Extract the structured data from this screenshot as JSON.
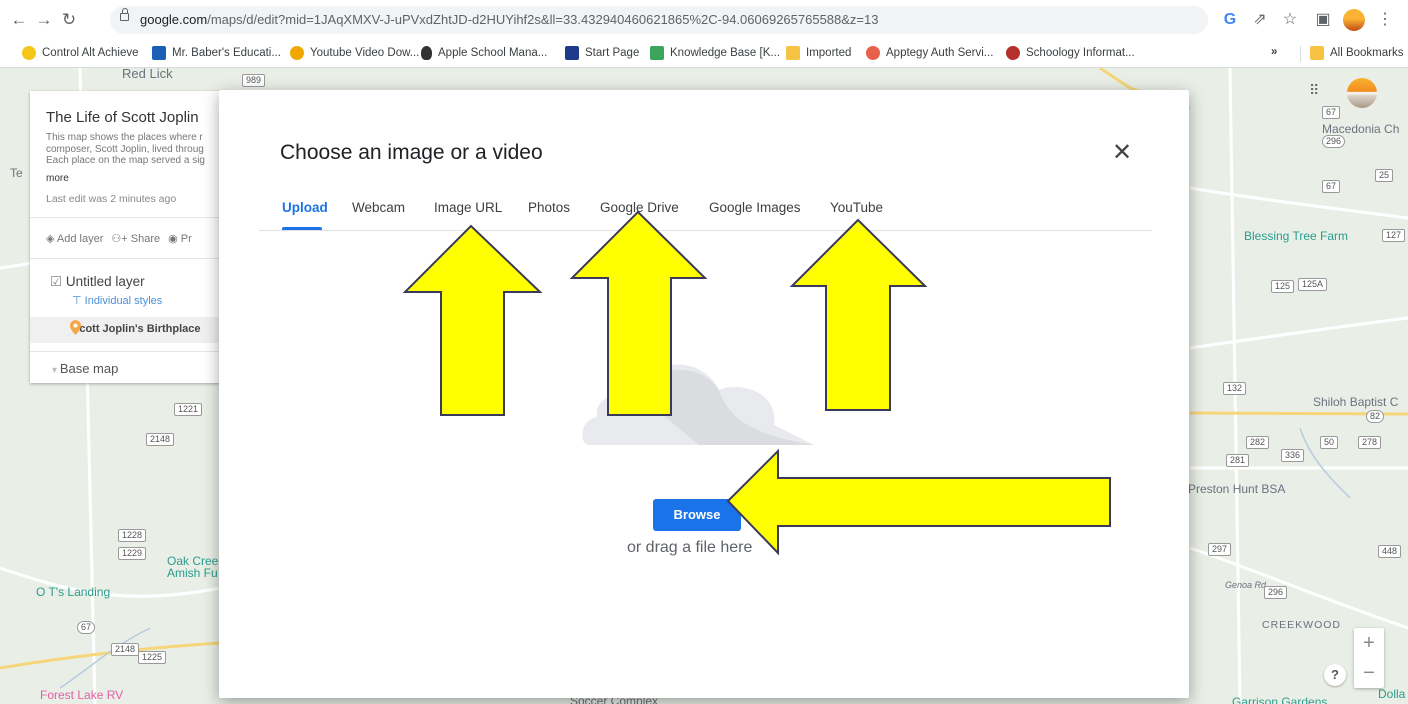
{
  "browser": {
    "url_host": "google.com",
    "url_path": "/maps/d/edit?mid=1JAqXMXV-J-uPVxdZhtJD-d2HUYihf2s&ll=33.432940460621865%2C-94.06069265765588&z=13",
    "back_icon": "arrow-left-icon",
    "forward_icon": "arrow-right-icon",
    "reload_icon": "reload-icon",
    "right_icons": [
      "google-icon",
      "share-icon",
      "star-icon",
      "sidepanel-icon",
      "profile-icon",
      "kebab-menu-icon"
    ]
  },
  "bookmarks": {
    "items": [
      {
        "label": "Control Alt Achieve",
        "color": "#f5c518"
      },
      {
        "label": "Mr. Baber's Educati...",
        "color": "#1a5fb4"
      },
      {
        "label": "Youtube Video Dow...",
        "color": "#f0a800"
      },
      {
        "label": "Apple School Mana...",
        "color": "#333333"
      },
      {
        "label": "Start Page",
        "color": "#1e3a8a"
      },
      {
        "label": "Knowledge Base [K...",
        "color": "#3ba55c"
      },
      {
        "label": "Imported",
        "color": "#f6c343"
      },
      {
        "label": "Apptegy Auth Servi...",
        "color": "#e8604c"
      },
      {
        "label": "Schoology Informat...",
        "color": "#b5302b"
      }
    ],
    "overflow": "»",
    "all_bookmarks": "All Bookmarks"
  },
  "map": {
    "places": {
      "red_lick": "Red Lick",
      "macedonia": "Macedonia Ch",
      "blessing_tree": "Blessing Tree Farm",
      "shiloh": "Shiloh Baptist C",
      "preston_hunt": "Preston Hunt BSA",
      "oak_creek_1": "Oak Cree",
      "oak_creek_2": "Amish Fu",
      "ots_landing": "O T's Landing",
      "forest_lake": "Forest Lake RV",
      "soccer": "Soccer Complex",
      "creekwood": "CREEKWOOD",
      "garrison": "Garrison Gardens",
      "dolla": "Dolla",
      "genoa_rd": "Genoa Rd",
      "te": "Te"
    },
    "routes": [
      "989",
      "67",
      "296",
      "67",
      "25",
      "127",
      "125",
      "125A",
      "132",
      "82",
      "282",
      "50",
      "278",
      "281",
      "336",
      "297",
      "448",
      "296",
      "1221",
      "2148",
      "1228",
      "1229",
      "67",
      "2148",
      "1225"
    ]
  },
  "panel": {
    "title": "The Life of Scott Joplin",
    "description": "This map shows the places where r composer, Scott Joplin, lived throug Each place on the map served a sig",
    "more": "more",
    "last_edit": "Last edit was 2 minutes ago",
    "add_layer": "Add layer",
    "share": "Share",
    "preview": "Pr",
    "layer_name": "Untitled layer",
    "layer_style": "Individual styles",
    "layer_item": "Scott Joplin's Birthplace",
    "base_map": "Base map"
  },
  "controls": {
    "zoom_in": "+",
    "zoom_out": "−",
    "help": "?"
  },
  "dialog": {
    "title": "Choose an image or a video",
    "close_icon": "close-icon",
    "tabs": [
      {
        "label": "Upload",
        "active": true
      },
      {
        "label": "Webcam",
        "active": false
      },
      {
        "label": "Image URL",
        "active": false
      },
      {
        "label": "Photos",
        "active": false
      },
      {
        "label": "Google Drive",
        "active": false
      },
      {
        "label": "Google Images",
        "active": false
      },
      {
        "label": "YouTube",
        "active": false
      }
    ],
    "browse": "Browse",
    "drag_text": "or drag a file here",
    "accent": "#1a73e8"
  },
  "annotation": {
    "arrow_color": "#ffff00",
    "arrow_outline": "#3a3a5a"
  }
}
